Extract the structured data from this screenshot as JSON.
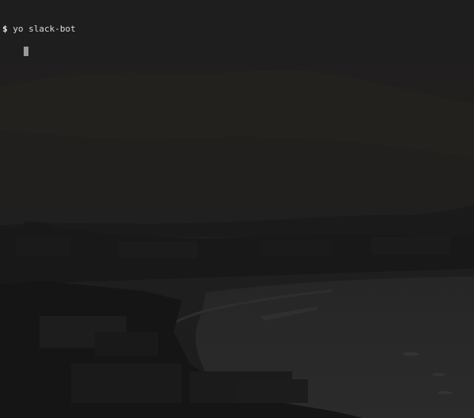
{
  "terminal": {
    "prompt_symbol": "$",
    "command": "yo slack-bot"
  },
  "colors": {
    "background": "#1c1c1c",
    "text": "#d8d8d8",
    "cursor": "#9a9a9a"
  },
  "icons": {
    "cursor": "block-cursor-icon",
    "background": "coastal-city-wallpaper"
  }
}
